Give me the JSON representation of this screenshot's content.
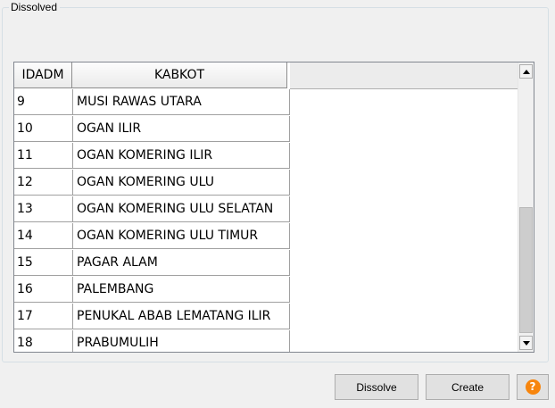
{
  "group": {
    "title": "Dissolved"
  },
  "table": {
    "columns": [
      "IDADM",
      "KABKOT"
    ],
    "rows": [
      {
        "id": "9",
        "name": "MUSI RAWAS UTARA"
      },
      {
        "id": "10",
        "name": "OGAN ILIR"
      },
      {
        "id": "11",
        "name": "OGAN KOMERING ILIR"
      },
      {
        "id": "12",
        "name": "OGAN KOMERING ULU"
      },
      {
        "id": "13",
        "name": "OGAN KOMERING ULU SELATAN"
      },
      {
        "id": "14",
        "name": "OGAN KOMERING ULU TIMUR"
      },
      {
        "id": "15",
        "name": "PAGAR ALAM"
      },
      {
        "id": "16",
        "name": "PALEMBANG"
      },
      {
        "id": "17",
        "name": "PENUKAL ABAB LEMATANG ILIR"
      },
      {
        "id": "18",
        "name": "PRABUMULIH"
      }
    ]
  },
  "buttons": {
    "dissolve": "Dissolve",
    "create": "Create",
    "help": "?"
  },
  "icons": {
    "help": "help-icon",
    "scroll_up": "chevron-up-icon",
    "scroll_down": "chevron-down-icon"
  },
  "colors": {
    "help_accent": "#f7850d"
  }
}
